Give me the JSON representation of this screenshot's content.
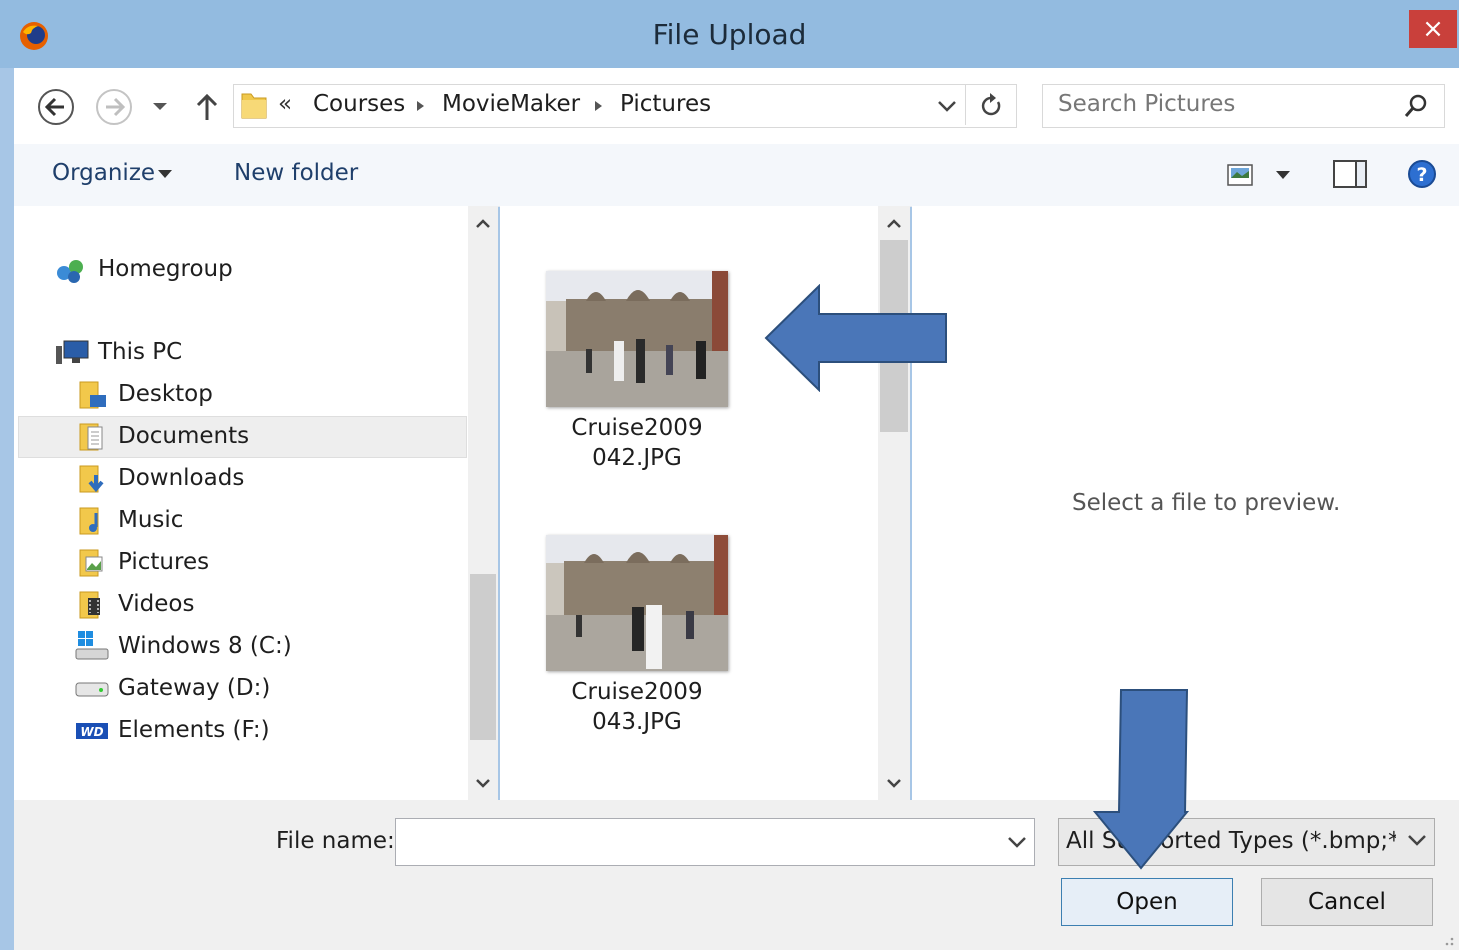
{
  "window": {
    "title": "File Upload",
    "close_label": "×"
  },
  "nav": {
    "breadcrumb": [
      "«",
      "Courses",
      "MovieMaker",
      "Pictures"
    ],
    "search_placeholder": "Search Pictures"
  },
  "toolbar": {
    "organize": "Organize",
    "new_folder": "New folder"
  },
  "sidebar": {
    "groups": [
      {
        "label": "Homegroup"
      },
      {
        "label": "This PC"
      }
    ],
    "items": [
      {
        "label": "Desktop"
      },
      {
        "label": "Documents"
      },
      {
        "label": "Downloads"
      },
      {
        "label": "Music"
      },
      {
        "label": "Pictures"
      },
      {
        "label": "Videos"
      },
      {
        "label": "Windows 8 (C:)"
      },
      {
        "label": "Gateway (D:)"
      },
      {
        "label": "Elements (F:)"
      }
    ]
  },
  "files": [
    {
      "line1": "Cruise2009",
      "line2": "042.JPG"
    },
    {
      "line1": "Cruise2009",
      "line2": "043.JPG"
    }
  ],
  "preview": {
    "message": "Select a file to preview."
  },
  "footer": {
    "filename_label": "File name:",
    "filename_value": "",
    "filetype_value": "All Supported Types (*.bmp;*.p",
    "open_label": "Open",
    "cancel_label": "Cancel"
  },
  "colors": {
    "arrow": "#4a76b8",
    "arrow_border": "#2c4f7c",
    "title_bar": "#93bbe0",
    "close": "#c9403b"
  }
}
